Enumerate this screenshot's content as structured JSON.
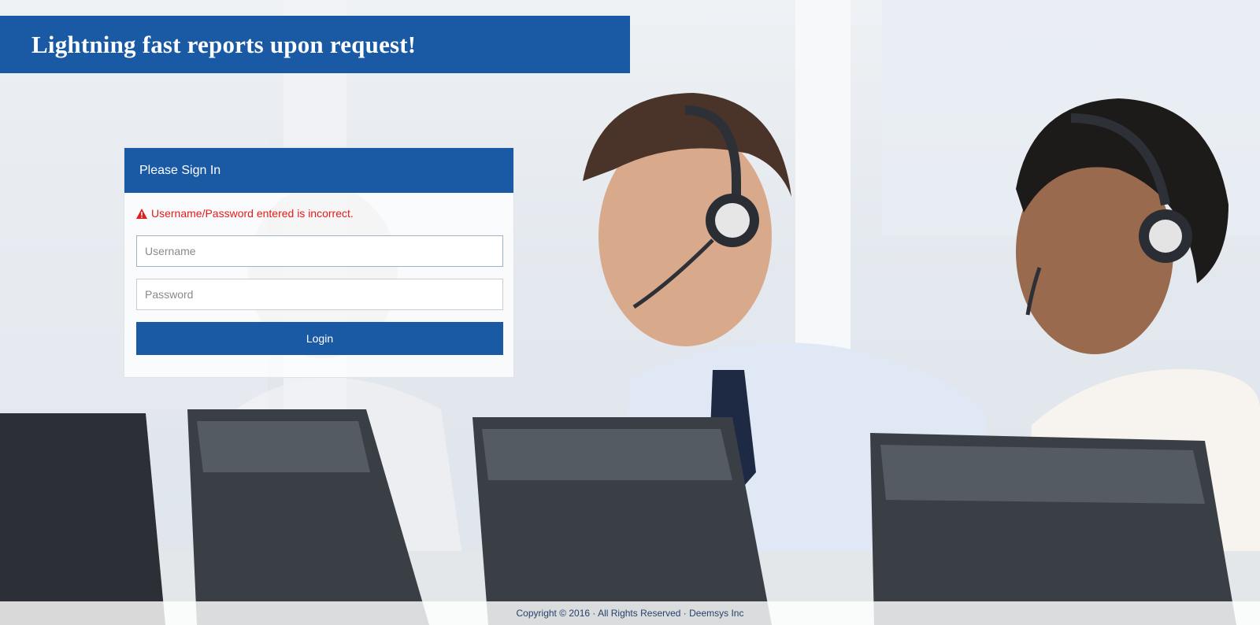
{
  "banner": {
    "title": "Lightning fast reports upon request!"
  },
  "login_panel": {
    "title": "Please Sign In",
    "error_icon": "warning-triangle-icon",
    "error_message": "Username/Password entered is incorrect.",
    "username": {
      "value": "",
      "placeholder": "Username"
    },
    "password": {
      "value": "",
      "placeholder": "Password"
    },
    "submit_label": "Login"
  },
  "footer": {
    "copyright": "Copyright © 2016 · All Rights Reserved · Deemsys Inc"
  },
  "colors": {
    "brand_blue": "#1a5aa5",
    "error_red": "#e41b1b",
    "footer_text": "#24436b"
  }
}
